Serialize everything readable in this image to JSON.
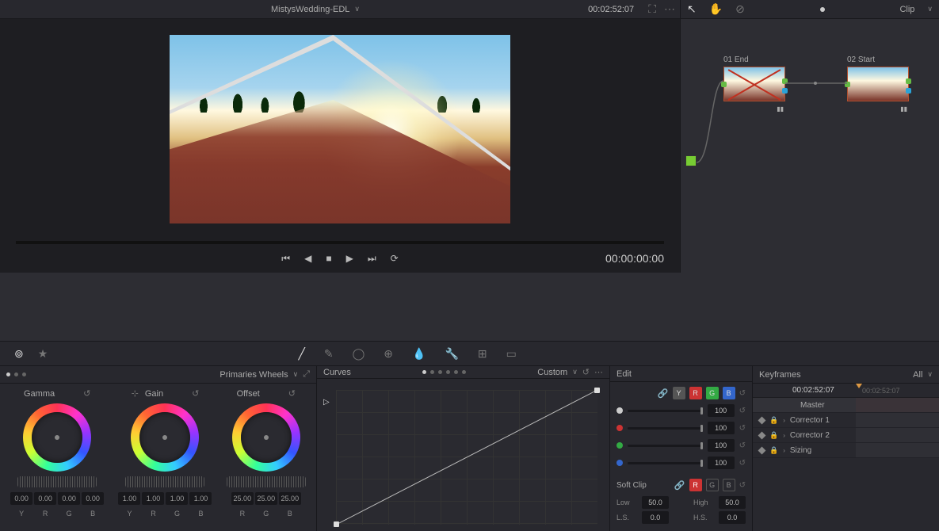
{
  "topbar": {
    "title": "MistysWedding-EDL",
    "timecode": "00:02:52:07",
    "mode_label": "Clip"
  },
  "viewer": {
    "transport_timecode": "00:00:00:00"
  },
  "nodes": {
    "n1": {
      "num": "01",
      "name": "End"
    },
    "n2": {
      "num": "02",
      "name": "Start"
    }
  },
  "wheels": {
    "panel_title": "Primaries Wheels",
    "cols": [
      {
        "title": "Gamma",
        "values": [
          "0.00",
          "0.00",
          "0.00",
          "0.00"
        ],
        "labels": [
          "Y",
          "R",
          "G",
          "B"
        ]
      },
      {
        "title": "Gain",
        "values": [
          "1.00",
          "1.00",
          "1.00",
          "1.00"
        ],
        "labels": [
          "Y",
          "R",
          "G",
          "B"
        ]
      },
      {
        "title": "Offset",
        "values": [
          "25.00",
          "25.00",
          "25.00"
        ],
        "labels": [
          "R",
          "G",
          "B"
        ]
      }
    ]
  },
  "curves": {
    "title": "Curves",
    "mode": "Custom",
    "edit_label": "Edit",
    "channels": [
      "Y",
      "R",
      "G",
      "B"
    ],
    "values": {
      "y": "100",
      "r": "100",
      "g": "100",
      "b": "100"
    },
    "softclip": {
      "title": "Soft Clip",
      "channels": [
        "R",
        "G",
        "B"
      ],
      "low_label": "Low",
      "low_val": "50.0",
      "high_label": "High",
      "high_val": "50.0",
      "ls_label": "L.S.",
      "ls_val": "0.0",
      "hs_label": "H.S.",
      "hs_val": "0.0"
    }
  },
  "keyframes": {
    "title": "Keyframes",
    "filter": "All",
    "tc_a": "00:02:52:07",
    "tc_b": "00:02:52:07",
    "rows": {
      "master": "Master",
      "c1": "Corrector 1",
      "c2": "Corrector 2",
      "sz": "Sizing"
    }
  }
}
